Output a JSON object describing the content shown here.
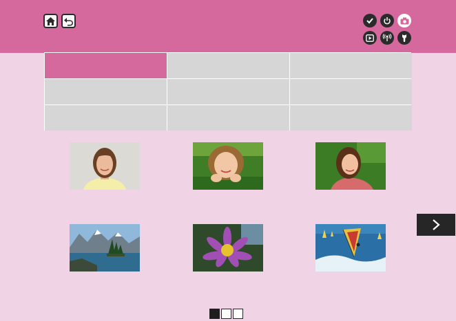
{
  "header": {
    "home_icon": "home-icon",
    "back_icon": "back-arrow-icon",
    "mode_icons": [
      {
        "name": "check-icon",
        "active": false
      },
      {
        "name": "power-icon",
        "active": false
      },
      {
        "name": "camera-icon",
        "active": true
      },
      {
        "name": "playback-icon",
        "active": false
      },
      {
        "name": "wireless-icon",
        "active": false
      },
      {
        "name": "wrench-icon",
        "active": false
      }
    ]
  },
  "menu_grid": {
    "rows": 3,
    "columns": 3,
    "selected_cell": 0
  },
  "thumbnails": [
    {
      "subject": "woman-portrait-white-background"
    },
    {
      "subject": "girl-lying-in-grass"
    },
    {
      "subject": "woman-portrait-green-background"
    },
    {
      "subject": "mountain-lake-landscape"
    },
    {
      "subject": "purple-water-lily"
    },
    {
      "subject": "windsurfer-on-waves"
    }
  ],
  "pagination": {
    "current": 1,
    "total": 3
  },
  "colors": {
    "header": "#d5699e",
    "background": "#f1d3e6",
    "cell": "#d6d6d6",
    "selected_cell": "#d5699e"
  }
}
